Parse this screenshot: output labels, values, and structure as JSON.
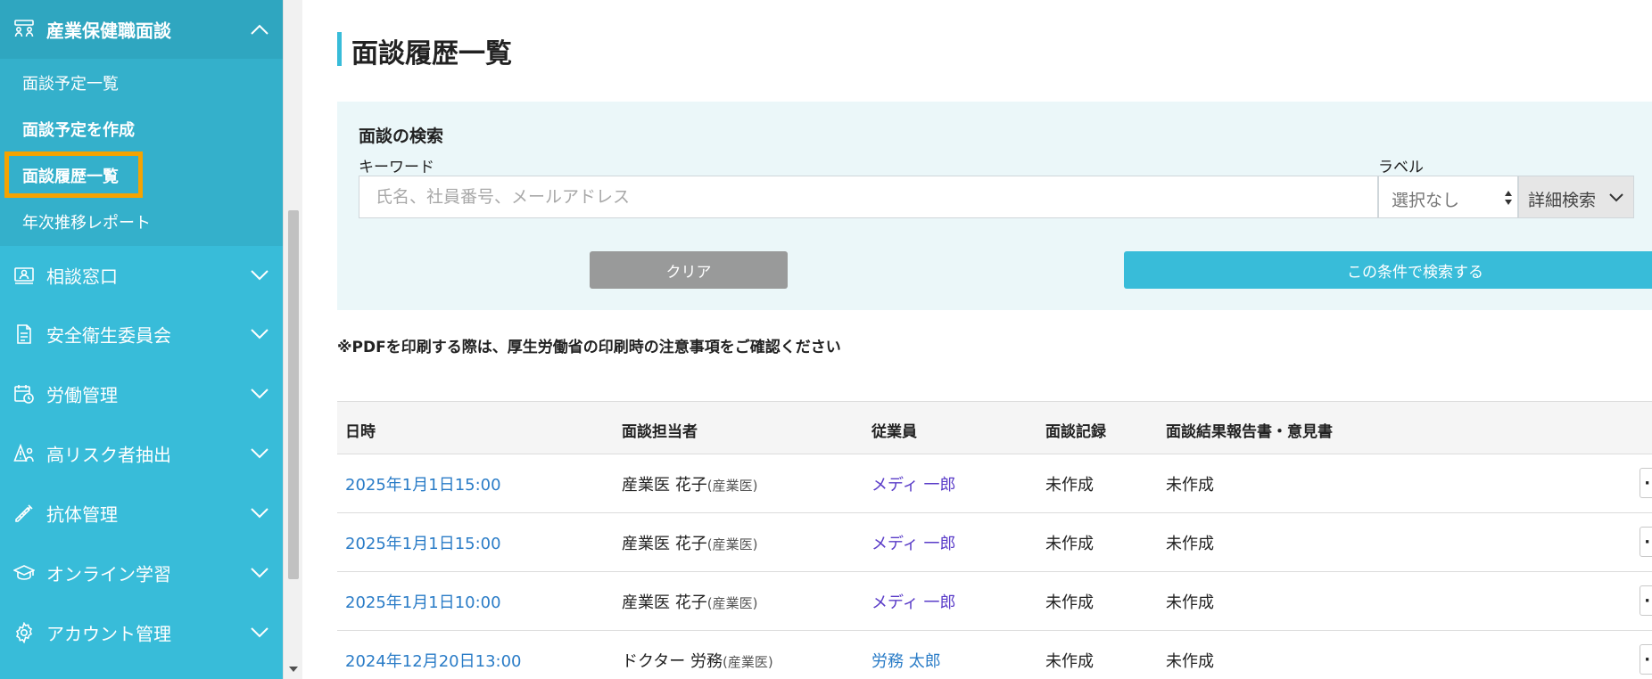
{
  "sidebar": {
    "active_section": {
      "label": "産業保健職面談",
      "icon": "interview-people-icon"
    },
    "sub_items": [
      {
        "label": "面談予定一覧"
      },
      {
        "label": "面談予定を作成"
      },
      {
        "label": "面談履歴一覧"
      },
      {
        "label": "年次推移レポート"
      }
    ],
    "sections": [
      {
        "label": "相談窓口",
        "icon": "consultation-icon"
      },
      {
        "label": "安全衛生委員会",
        "icon": "document-icon"
      },
      {
        "label": "労働管理",
        "icon": "calendar-clock-icon"
      },
      {
        "label": "高リスク者抽出",
        "icon": "risk-person-icon"
      },
      {
        "label": "抗体管理",
        "icon": "syringe-icon"
      },
      {
        "label": "オンライン学習",
        "icon": "graduation-cap-icon"
      },
      {
        "label": "アカウント管理",
        "icon": "gear-icon"
      }
    ],
    "colors": {
      "background": "#38bcd9",
      "highlight": "#f5a300"
    }
  },
  "main": {
    "page_title": "面談履歴一覧",
    "search": {
      "heading": "面談の検索",
      "keyword_label": "キーワード",
      "keyword_placeholder": "氏名、社員番号、メールアドレス",
      "keyword_value": "",
      "label_label": "ラベル",
      "label_selected": "選択なし",
      "advanced_label": "詳細検索",
      "clear_label": "クリア",
      "submit_label": "この条件で検索する"
    },
    "pdf_notice": "※PDFを印刷する際は、厚生労働省の印刷時の注意事項をご確認ください",
    "table": {
      "headers": [
        "日時",
        "面談担当者",
        "従業員",
        "面談記録",
        "面談結果報告書・意見書"
      ],
      "rows": [
        {
          "datetime": "2025年1月1日15:00",
          "staff": "産業医 花子",
          "staff_role": "(産業医)",
          "employee": "メディ 一郎",
          "record": "未作成",
          "report": "未作成",
          "more": "···"
        },
        {
          "datetime": "2025年1月1日15:00",
          "staff": "産業医 花子",
          "staff_role": "(産業医)",
          "employee": "メディ 一郎",
          "record": "未作成",
          "report": "未作成",
          "more": "···"
        },
        {
          "datetime": "2025年1月1日10:00",
          "staff": "産業医 花子",
          "staff_role": "(産業医)",
          "employee": "メディ 一郎",
          "record": "未作成",
          "report": "未作成",
          "more": "···"
        },
        {
          "datetime": "2024年12月20日13:00",
          "staff": "ドクター 労務",
          "staff_role": "(産業医)",
          "employee": "労務 太郎",
          "record": "未作成",
          "report": "未作成",
          "more": "···"
        }
      ]
    }
  }
}
